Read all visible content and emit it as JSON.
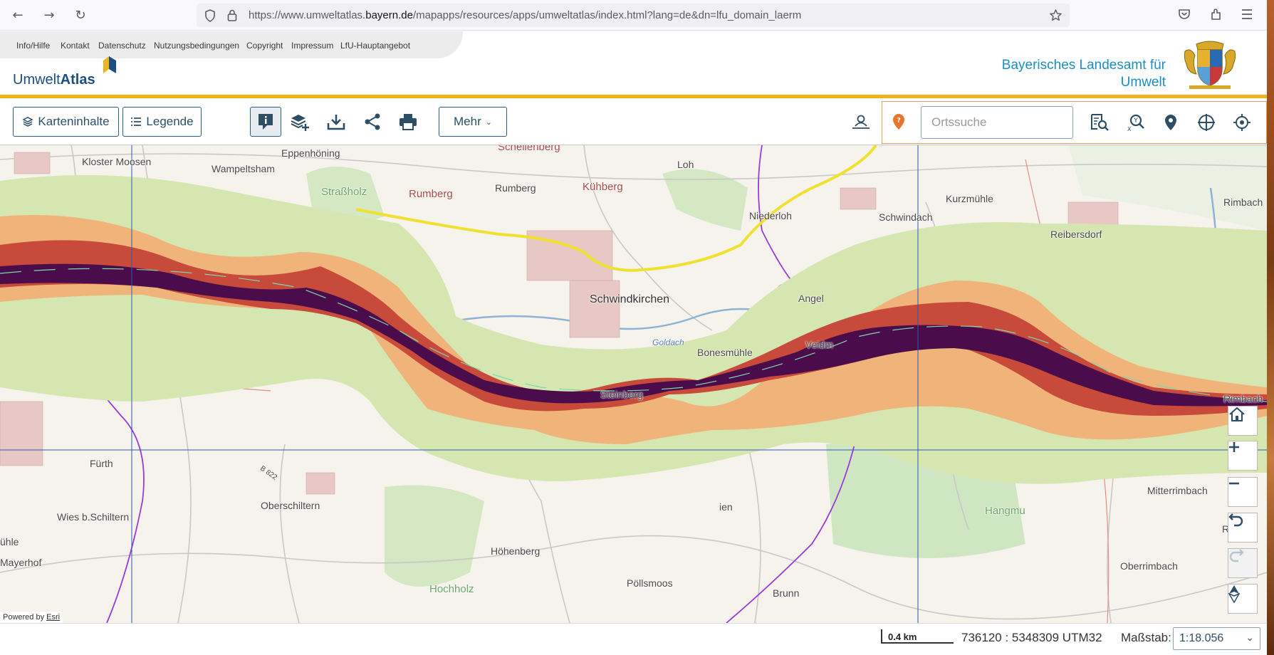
{
  "browser": {
    "url_prefix": "https://www.umweltatlas.",
    "url_domain": "bayern.de",
    "url_suffix": "/mapapps/resources/apps/umweltatlas/index.html?lang=de&dn=lfu_domain_laerm"
  },
  "header": {
    "links": [
      "Info/Hilfe",
      "Kontakt",
      "Datenschutz",
      "Nutzungsbedingungen",
      "Copyright",
      "Impressum",
      "LfU-Hauptangebot"
    ],
    "logo_light": "Umwelt",
    "logo_bold": "Atlas",
    "org_line1": "Bayerisches Landesamt für",
    "org_line2": "Umwelt"
  },
  "toolbar": {
    "karteninhalte": "Karteninhalte",
    "legende": "Legende",
    "mehr": "Mehr",
    "search_placeholder": "Ortssuche"
  },
  "map": {
    "places": [
      "Kloster Moosen",
      "Wampeltsham",
      "Eppenhöning",
      "Schellenberg",
      "Loh",
      "Straßholz",
      "Rumberg",
      "Rumberg",
      "Kühberg",
      "Niederloh",
      "Schwindach",
      "Kurzmühle",
      "Rimbach",
      "Reibersdorf",
      "Schwindkirchen",
      "Angel",
      "Goldach",
      "Bonesmühle",
      "Veidm",
      "Steinberg",
      "Rimbach",
      "Fürth",
      "B 822",
      "Oberschiltern",
      "Wies b.Schiltern",
      "Mitterrimbach",
      "Hangmu",
      "Rimba",
      "ühle",
      "Mayerhof",
      "Höhenberg",
      "Oberrimbach",
      "Pöllsmoos",
      "Hochholz",
      "Brunn",
      "ien"
    ],
    "powered_by": "Powered by",
    "esri": "Esri"
  },
  "status": {
    "scale_label": "0.4 km",
    "coordinates": "736120 : 5348309  UTM32",
    "massstab_label": "Maßstab:",
    "massstab_value": "1:18.056"
  },
  "colors": {
    "accent_yellow": "#f0b31c",
    "brand_blue": "#1b8ec2",
    "noise_light": "#d6e6b0",
    "noise_orange": "#f0b47a",
    "noise_red": "#c84a3a",
    "noise_darkred": "#8a1c3a",
    "noise_purple": "#4a0c4a"
  }
}
